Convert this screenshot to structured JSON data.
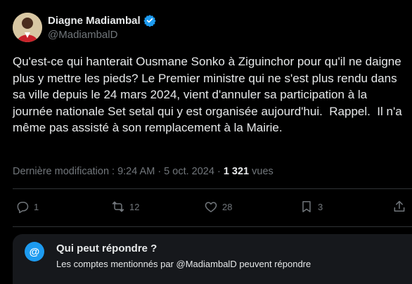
{
  "author": {
    "name": "Diagne Madiambal",
    "handle": "@MadiambalD",
    "verified_color": "#1d9bf0"
  },
  "tweet": {
    "text": "Qu'est-ce qui hanterait Ousmane Sonko à Ziguinchor pour qu'il ne daigne plus y mettre les pieds? Le Premier ministre qui ne s'est plus rendu dans sa ville depuis le 24 mars 2024, vient d'annuler sa participation à la journée nationale Set setal qui y est organisée aujourd'hui.  Rappel.  Il n'a même pas assisté à son remplacement à la Mairie."
  },
  "meta": {
    "edited_label": "Dernière modification : 9:24 AM · 5 oct. 2024 · ",
    "views_count": "1 321",
    "views_label": " vues"
  },
  "actions": {
    "replies": "1",
    "reposts": "12",
    "likes": "28",
    "bookmarks": "3"
  },
  "reply_restriction": {
    "icon_text": "@",
    "title": "Qui peut répondre ?",
    "subtitle": "Les comptes mentionnés par @MadiambalD peuvent répondre"
  },
  "colors": {
    "background": "#000000",
    "text": "#e7e9ea",
    "muted": "#71767b",
    "accent": "#1d9bf0",
    "panel": "#16181c"
  },
  "icons": [
    "reply-icon",
    "repost-icon",
    "like-icon",
    "bookmark-icon",
    "share-icon",
    "verified-badge-icon",
    "at-icon"
  ]
}
